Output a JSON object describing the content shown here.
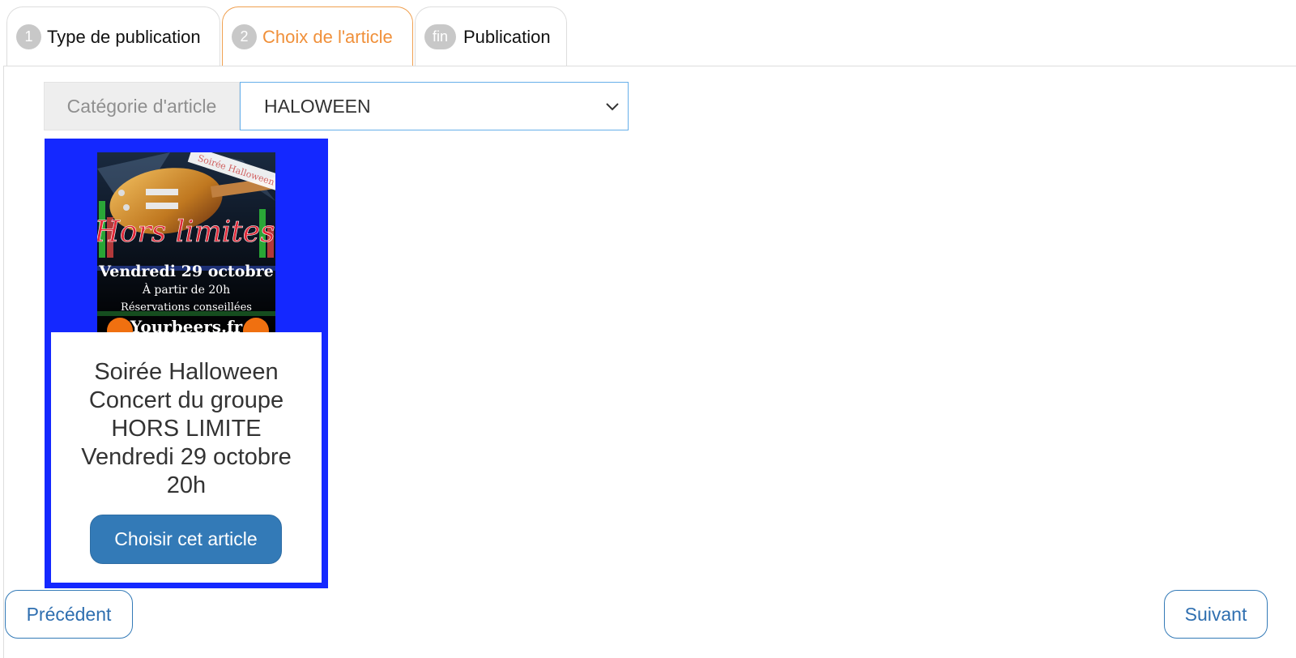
{
  "tabs": [
    {
      "num": "1",
      "label": "Type de publication",
      "active": false
    },
    {
      "num": "2",
      "label": "Choix de l'article",
      "active": true
    },
    {
      "num": "fin",
      "label": "Publication",
      "active": false
    }
  ],
  "category": {
    "label": "Catégorie d'article",
    "selected": "HALOWEEN",
    "icon": "chevron-down-icon"
  },
  "article": {
    "poster": {
      "banner": "Soirée Halloween",
      "band": "Hors limites",
      "date": "Vendredi 29 octobre",
      "time": "À partir de 20h",
      "note": "Réservations conseillées",
      "site": "Yourbeers.fr"
    },
    "lines": [
      "Soirée Halloween",
      "Concert du groupe",
      "HORS LIMITE",
      "Vendredi 29 octobre",
      "20h"
    ],
    "button": "Choisir cet article"
  },
  "nav": {
    "prev": "Précédent",
    "next": "Suivant"
  },
  "colors": {
    "accent_orange": "#f0903a",
    "card_border": "#1428ff",
    "primary": "#337ab7",
    "step_badge": "#c8c8c8"
  }
}
